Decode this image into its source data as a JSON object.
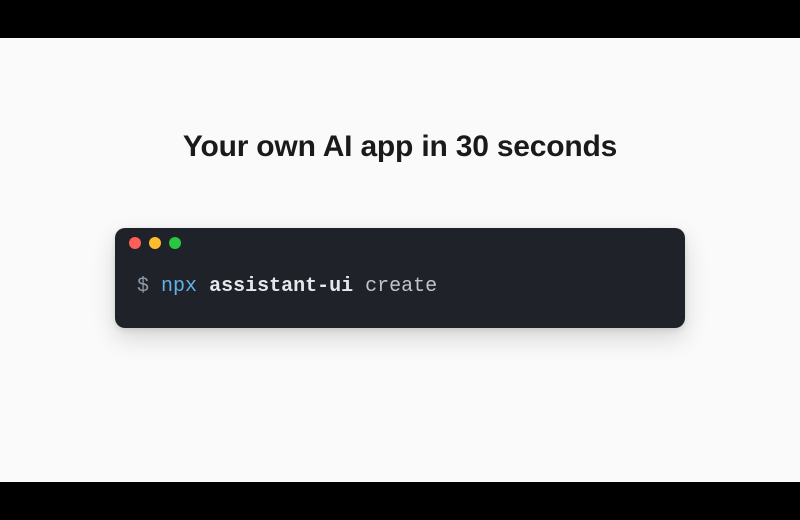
{
  "headline": "Your own AI app in 30 seconds",
  "terminal": {
    "traffic_lights": {
      "close": "close",
      "minimize": "minimize",
      "maximize": "maximize"
    },
    "prompt_symbol": "$",
    "command": {
      "runner": "npx",
      "package": "assistant-ui",
      "subcommand": "create"
    }
  }
}
